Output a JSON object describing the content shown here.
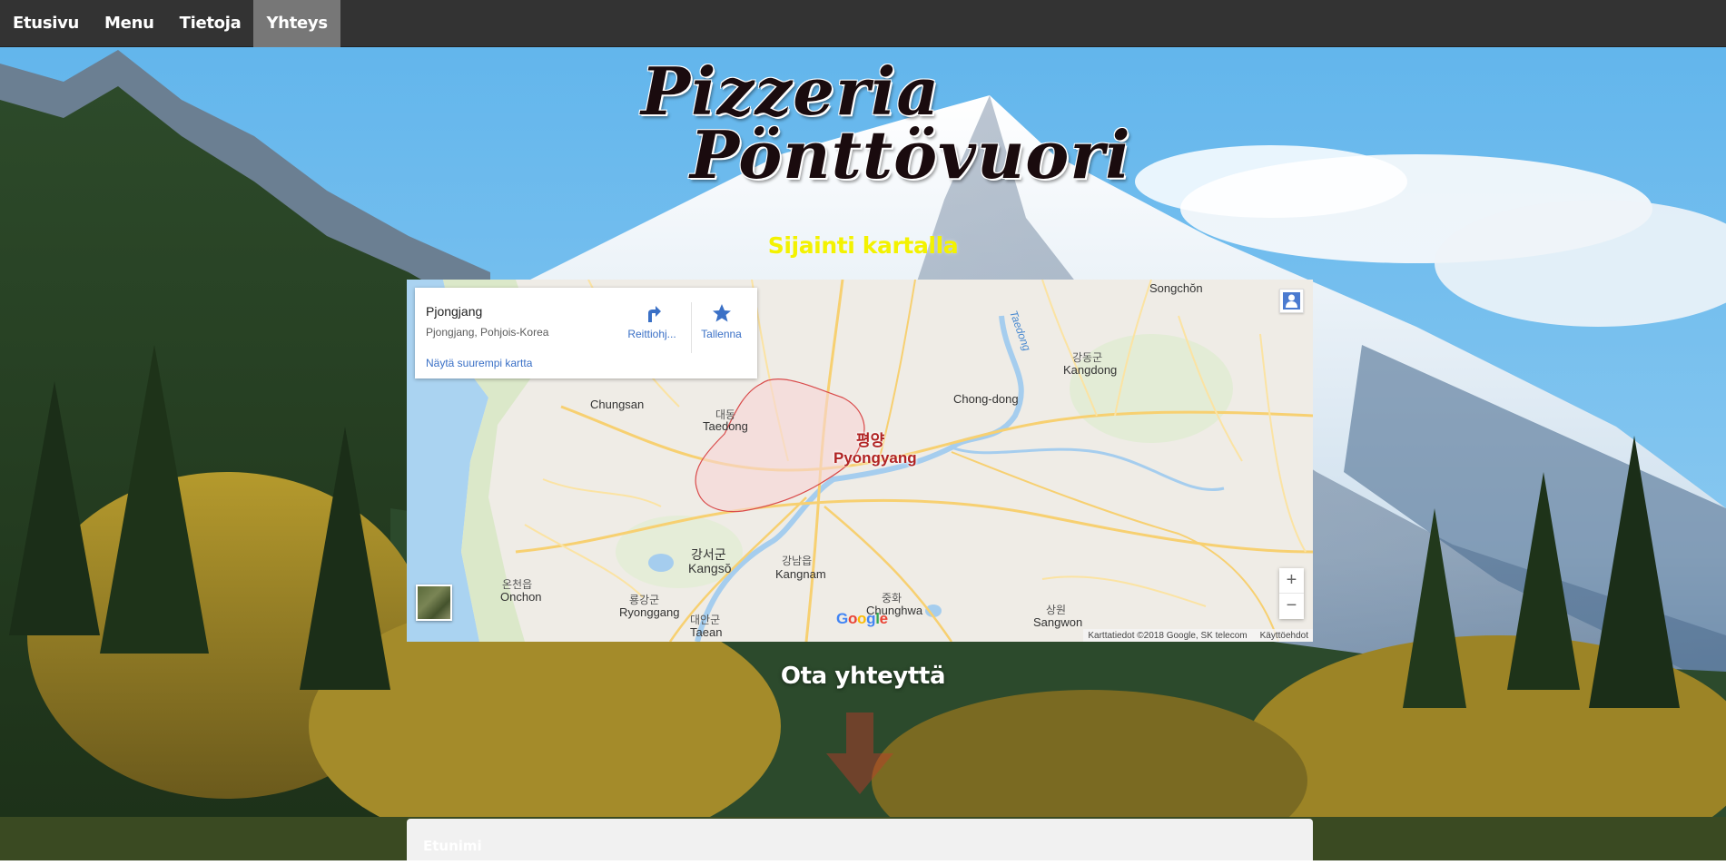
{
  "nav": {
    "items": [
      {
        "label": "Etusivu"
      },
      {
        "label": "Menu"
      },
      {
        "label": "Tietoja"
      },
      {
        "label": "Yhteys"
      }
    ],
    "active": "Yhteys"
  },
  "logo": {
    "line1": "Pizzeria",
    "line2": "Pönttövuori"
  },
  "map_section": {
    "heading": "Sijainti kartalla",
    "card": {
      "title": "Pjongjang",
      "address": "Pjongjang, Pohjois-Korea",
      "directions_label": "Reittiohj...",
      "save_label": "Tallenna",
      "larger_map_link": "Näytä suurempi kartta"
    },
    "labels": {
      "songchon": "Songchŏn",
      "kangdong_kr": "강동군",
      "kangdong": "Kangdong",
      "taedong_river": "Taedong",
      "chong_dong": "Chong-dong",
      "chungsan": "Chungsan",
      "taedong_kr": "대동",
      "taedong": "Taedong",
      "pyongyang_kr": "평양",
      "pyongyang": "Pyongyang",
      "kangso_kr": "강서군",
      "kangso": "Kangsŏ",
      "kangnam_kr": "강남읍",
      "kangnam": "Kangnam",
      "onchon_kr": "온천읍",
      "onchon": "Onchon",
      "ryonggang_kr": "룡강군",
      "ryonggang": "Ryonggang",
      "taean_kr": "대안군",
      "taean": "Taean",
      "chunghwa_kr": "중화",
      "chunghwa": "Chunghwa",
      "sangwon_kr": "상원",
      "sangwon": "Sangwon"
    },
    "zoom_in": "+",
    "zoom_out": "−",
    "google": "Google",
    "attribution": "Karttatiedot ©2018 Google, SK telecom",
    "terms": "Käyttöehdot"
  },
  "contact": {
    "heading": "Ota yhteyttä",
    "first_name_placeholder": "Etunimi"
  },
  "colors": {
    "nav_bg": "#333333",
    "nav_active": "#777777",
    "map_heading": "#f3f200",
    "capital_outline": "#d94a4a",
    "map_link": "#3a70c6"
  }
}
